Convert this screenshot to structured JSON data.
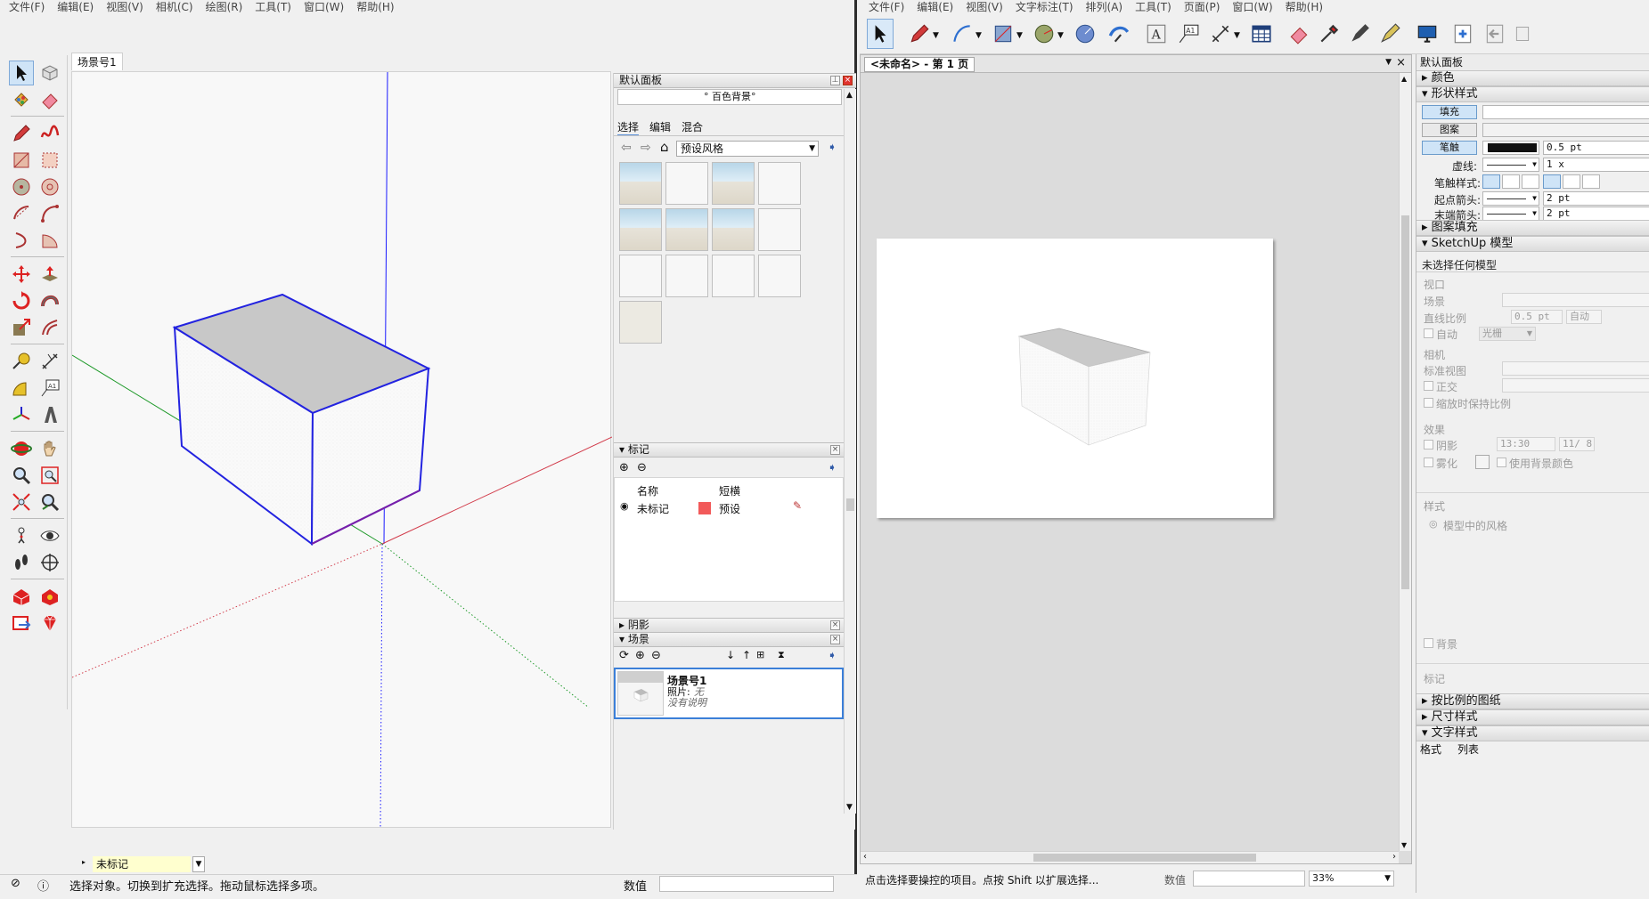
{
  "left_app": {
    "menu": [
      "文件(F)",
      "编辑(E)",
      "视图(V)",
      "相机(C)",
      "绘图(R)",
      "工具(T)",
      "窗口(W)",
      "帮助(H)"
    ],
    "scene_tab": "场景号1",
    "tray": {
      "title": "默认面板",
      "style_dropdown_partial": "° 百色背景°",
      "style_tabs": [
        "选择",
        "编辑",
        "混合"
      ],
      "style_library": "预设风格",
      "tags_panel": {
        "title": "标记",
        "col_name": "名称",
        "col_dash": "短横",
        "row_name": "未标记",
        "row_dash": "预设",
        "row_color": "#f25a5a"
      },
      "shadow_panel_title": "阴影",
      "scenes_panel": {
        "title": "场景",
        "scene_name": "场景号1",
        "photo_label": "照片:",
        "photo_value": "无",
        "description": "没有说明"
      }
    },
    "tag_selector_value": "未标记",
    "status_text": "选择对象。切换到扩充选择。拖动鼠标选择多项。",
    "measurements_label": "数值"
  },
  "right_app": {
    "menu": [
      "文件(F)",
      "编辑(E)",
      "视图(V)",
      "文字标注(T)",
      "排列(A)",
      "工具(T)",
      "页面(P)",
      "窗口(W)",
      "帮助(H)"
    ],
    "doc_tab": "<未命名> - 第 1 页",
    "status_text": "点击选择要操控的项目。点按 Shift 以扩展选择...",
    "measure_label": "数值",
    "zoom": "33%",
    "panel": {
      "title": "默认面板",
      "sections": {
        "colors": "颜色",
        "shape_style": "形状样式",
        "pattern_fill": "图案填充",
        "sketchup_model": "SketchUp 模型",
        "scaled_drawing": "按比例的图纸",
        "dimension_style": "尺寸样式",
        "text_style": "文字样式"
      },
      "shape": {
        "fill": "填充",
        "pattern": "图案",
        "stroke": "笔触",
        "stroke_width": "0.5 pt",
        "dash_label": "虚线:",
        "dash_scale": "1 x",
        "stroke_style_label": "笔触样式:",
        "start_arrow_label": "起点箭头:",
        "start_arrow_size": "2 pt",
        "end_arrow_label": "末端箭头:",
        "end_arrow_size": "2 pt"
      },
      "model": {
        "no_selection": "未选择任何模型",
        "viewport": "视口",
        "scene": "场景",
        "line_scale": "直线比例",
        "line_scale_value": "0.5 pt",
        "auto_button": "自动",
        "auto_check": "自动",
        "render_mode": "光栅",
        "camera": "相机",
        "standard_view": "标准视图",
        "ortho": "正交",
        "preserve_scale": "缩放时保持比例",
        "effects": "效果",
        "shadows": "阴影",
        "shadow_time": "13:30",
        "shadow_date": "11/ 8",
        "fog": "雾化",
        "use_bg_color": "使用背景颜色",
        "styles": "样式",
        "model_style": "模型中的风格",
        "background": "背景",
        "tags": "标记"
      },
      "bottom_tabs": [
        "格式",
        "列表"
      ]
    }
  },
  "colors": {
    "blue_axis": "#1a1aff",
    "red_axis": "#d23c4b",
    "green_axis": "#1f9a2a",
    "selection": "#2323e0",
    "tag_red": "#f25a5a"
  }
}
